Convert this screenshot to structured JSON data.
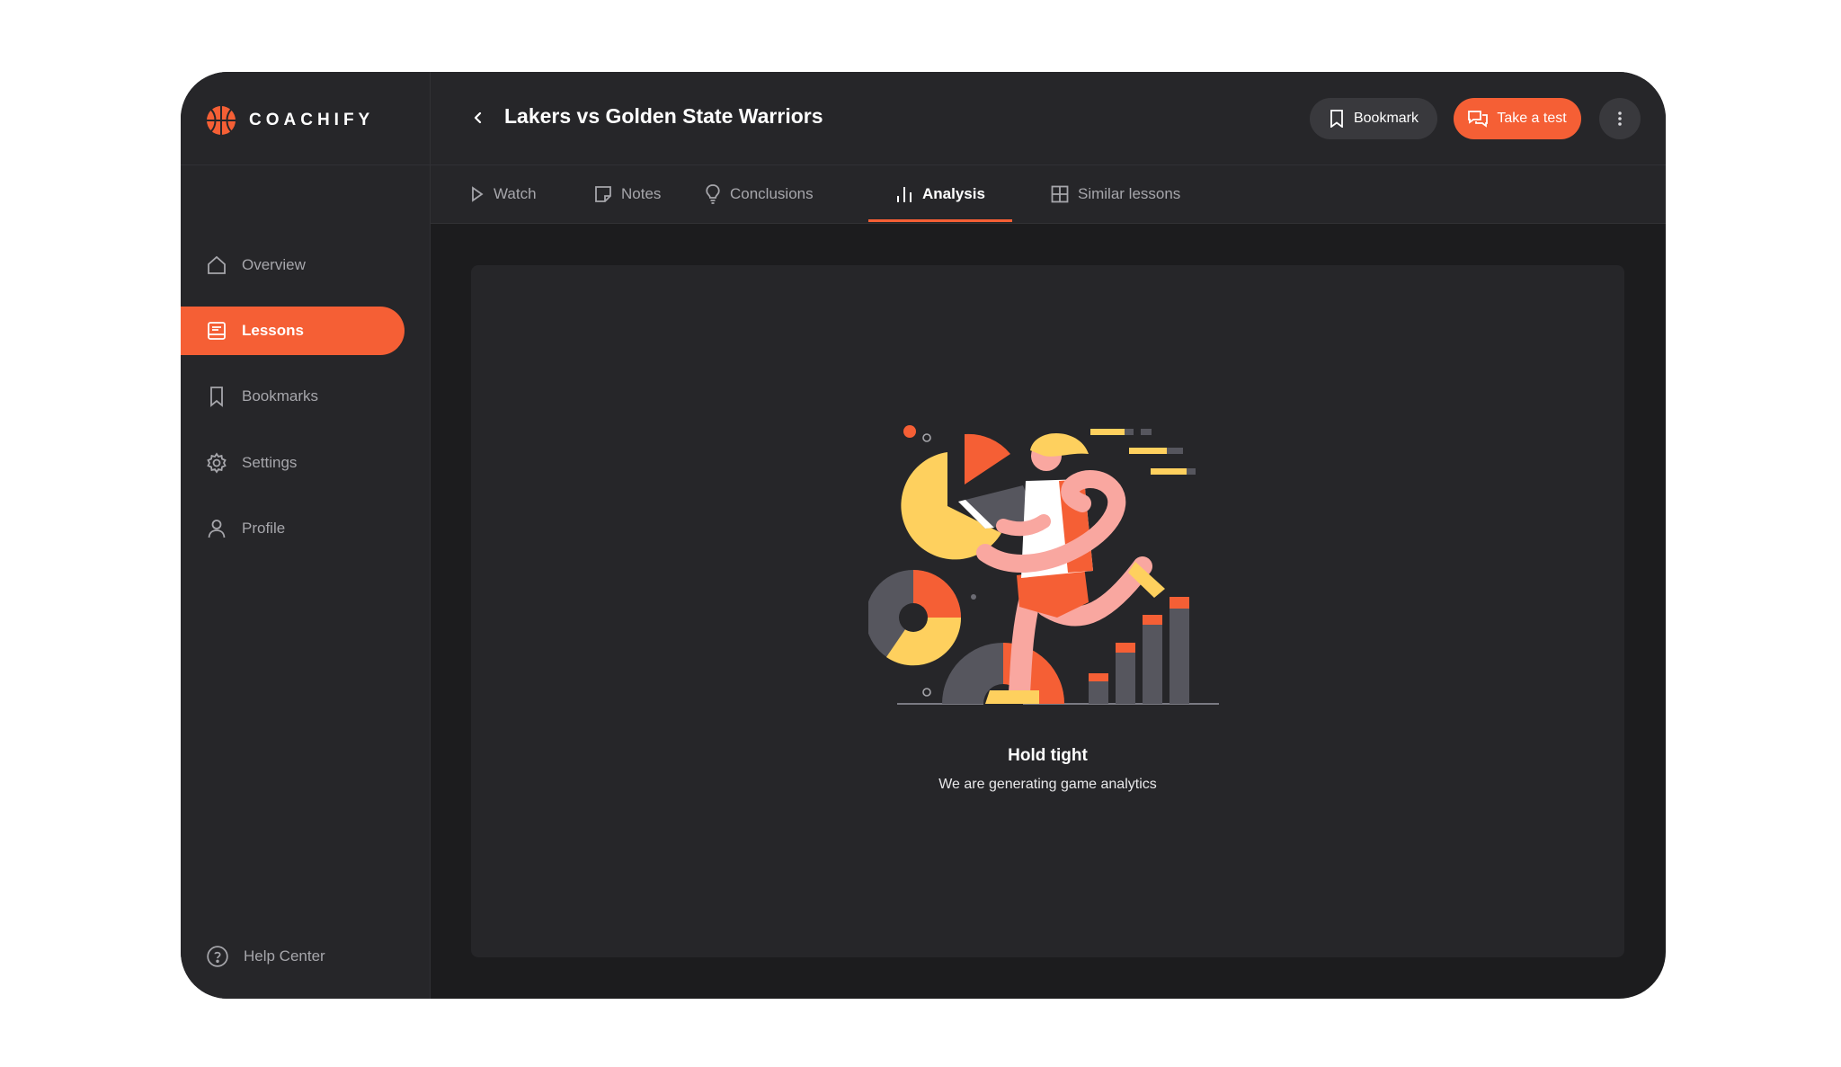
{
  "app": {
    "brand": "COACHIFY",
    "colors": {
      "accent": "#f55f35",
      "sidebar": "#262629",
      "background": "#1c1c1e",
      "yellow": "#fed05e",
      "pink": "#f9a7a0",
      "slate": "#56565e"
    }
  },
  "sidebar": {
    "items": [
      {
        "label": "Overview",
        "icon": "home-icon"
      },
      {
        "label": "Lessons",
        "icon": "lesson-icon",
        "active": true
      },
      {
        "label": "Bookmarks",
        "icon": "bookmark-icon"
      },
      {
        "label": "Settings",
        "icon": "gear-icon"
      },
      {
        "label": "Profile",
        "icon": "user-icon"
      }
    ],
    "help": "Help Center"
  },
  "header": {
    "title": "Lakers vs Golden State Warriors",
    "bookmark_label": "Bookmark",
    "test_label": "Take a test"
  },
  "tabs": [
    {
      "label": "Watch",
      "icon": "play-icon"
    },
    {
      "label": "Notes",
      "icon": "note-icon"
    },
    {
      "label": "Conclusions",
      "icon": "bulb-icon"
    },
    {
      "label": "Analysis",
      "icon": "bar-chart-icon",
      "active": true
    },
    {
      "label": "Similar lessons",
      "icon": "grid-icon"
    }
  ],
  "content": {
    "title": "Hold tight",
    "subtitle": "We are generating game analytics"
  }
}
